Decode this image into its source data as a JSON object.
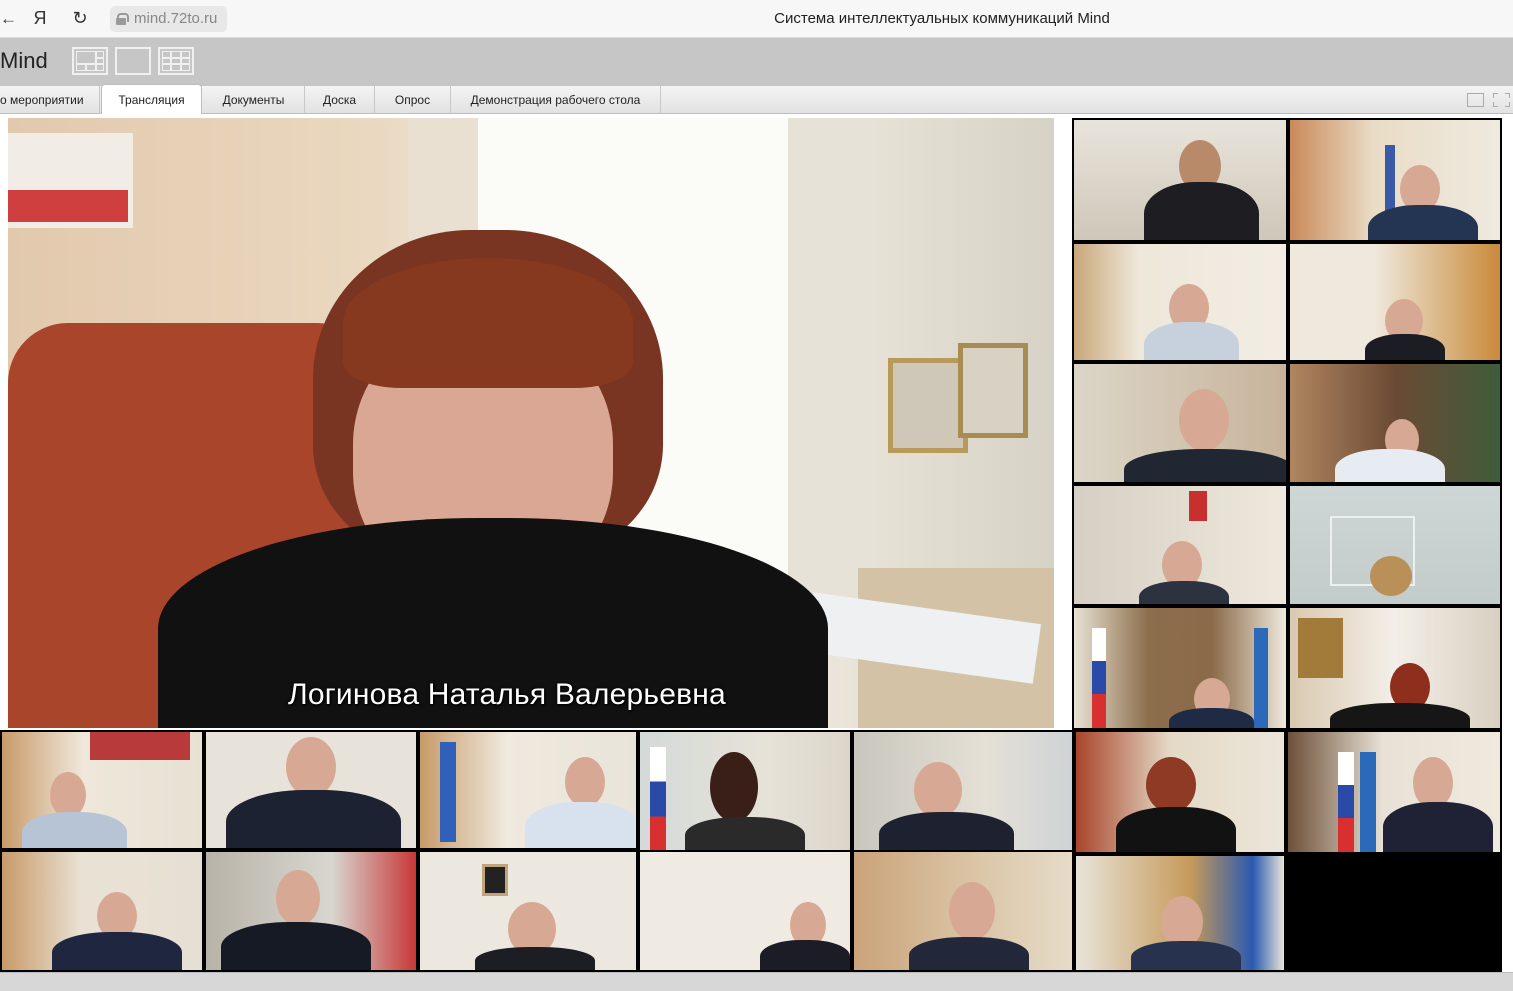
{
  "browser": {
    "back_glyph": "←",
    "yandex_glyph": "Я",
    "reload_glyph": "↻",
    "url": "mind.72to.ru",
    "page_title": "Система интеллектуальных коммуникаций Mind"
  },
  "app": {
    "name": "Mind"
  },
  "tabs": [
    {
      "label": "о мероприятии",
      "active": false
    },
    {
      "label": "Трансляция",
      "active": true
    },
    {
      "label": "Документы",
      "active": false
    },
    {
      "label": "Доска",
      "active": false
    },
    {
      "label": "Опрос",
      "active": false
    },
    {
      "label": "Демонстрация рабочего стола",
      "active": false
    }
  ],
  "main_speaker": {
    "name": "Логинова Наталья Валерьевна"
  },
  "colors": {
    "header_bg": "#c6c6c6",
    "tab_active": "#ffffff",
    "stage_border": "#000000"
  },
  "icons": {
    "layout_mixed": "layout-mixed-icon",
    "layout_single": "layout-single-icon",
    "layout_grid": "layout-grid-icon",
    "window": "window-icon",
    "fullscreen": "fullscreen-icon"
  }
}
